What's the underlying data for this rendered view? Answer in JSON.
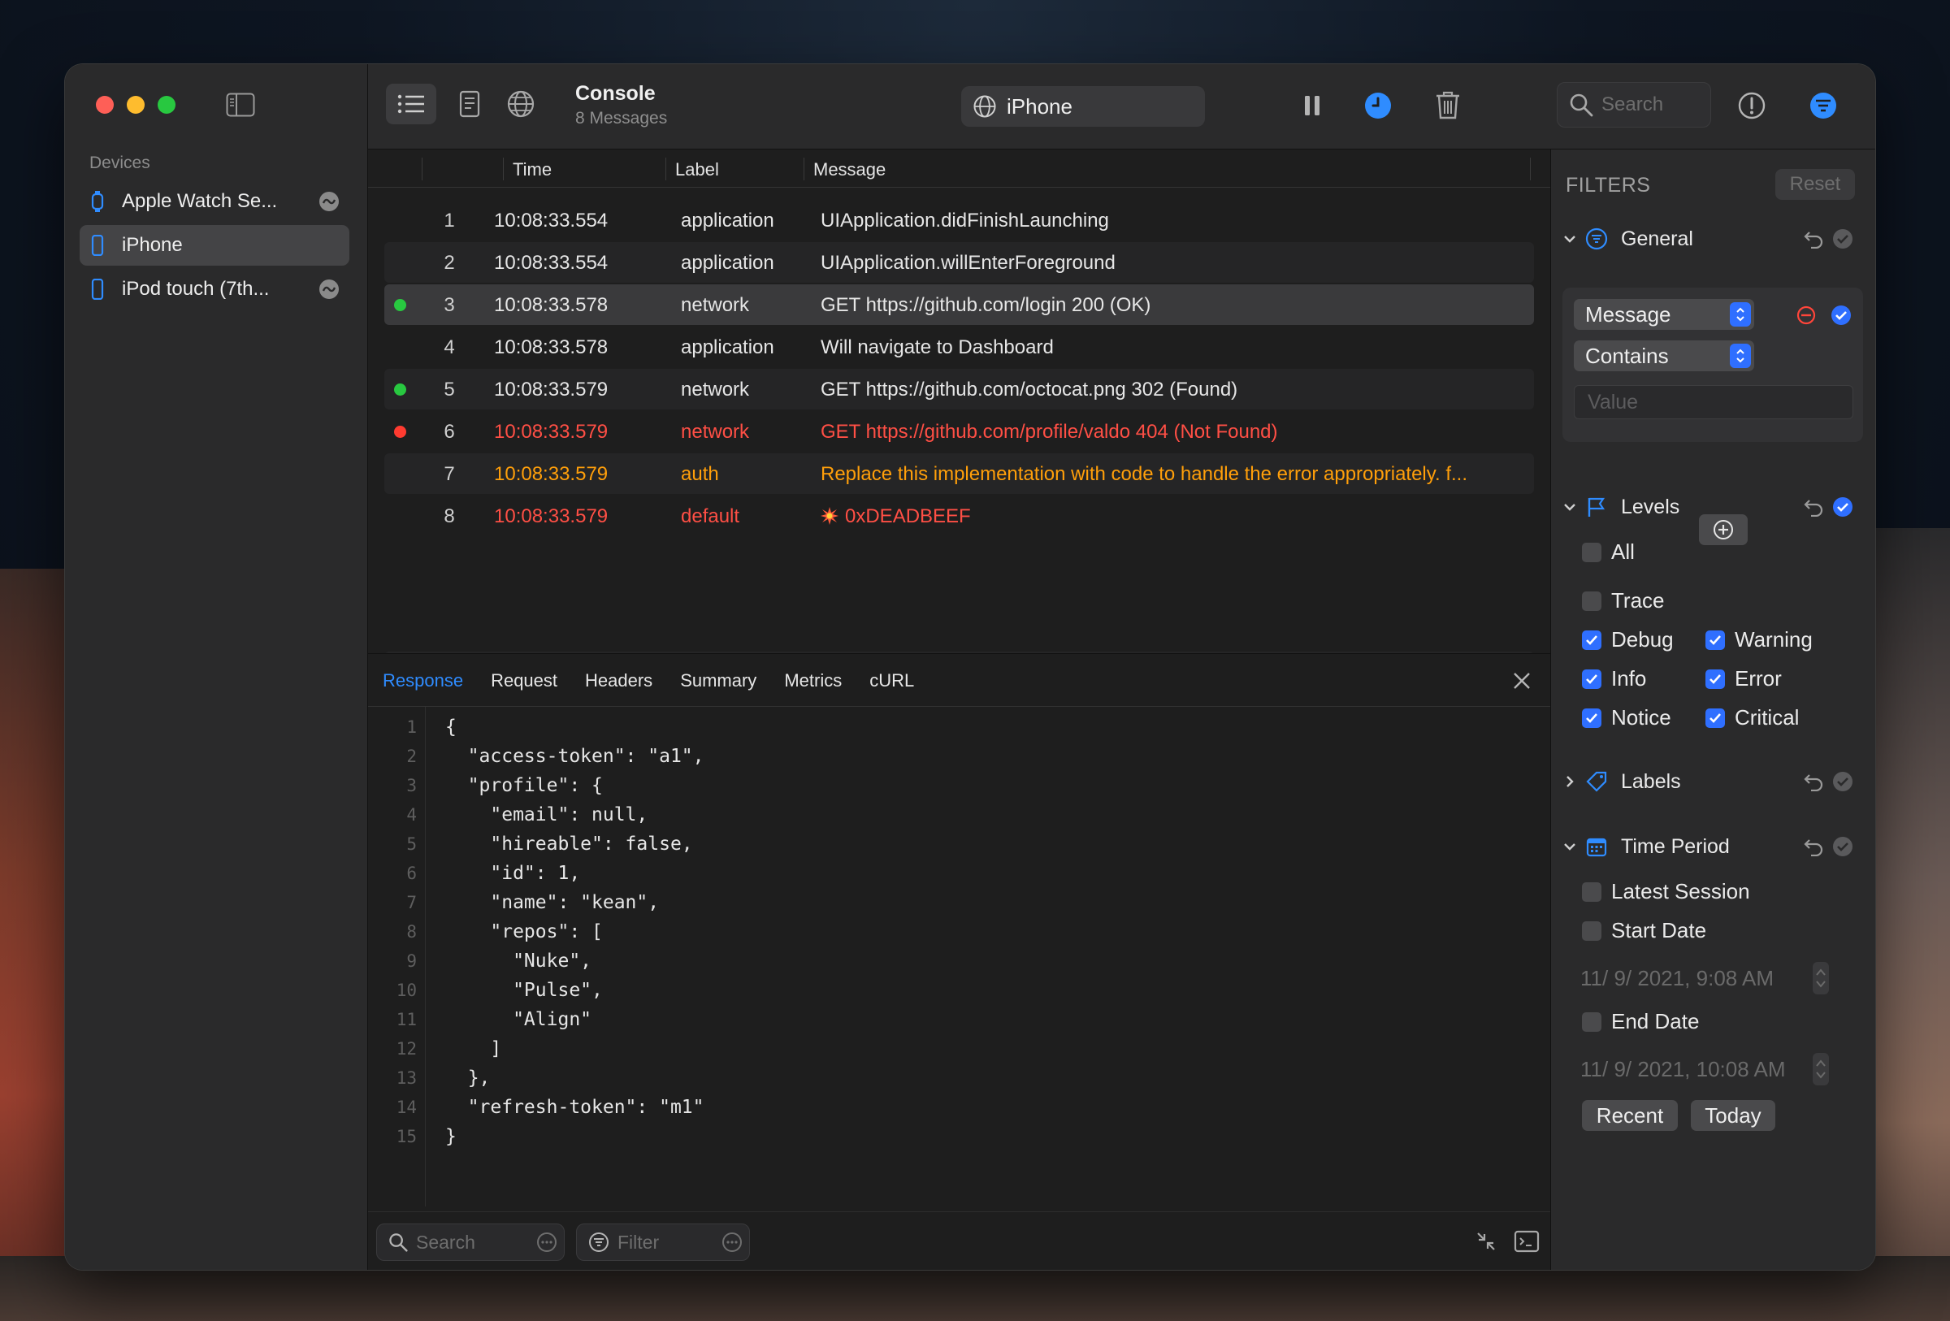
{
  "sidebar": {
    "heading": "Devices",
    "devices": [
      {
        "label": "Apple Watch Se...",
        "icon": "watch-icon"
      },
      {
        "label": "iPhone",
        "icon": "phone-icon",
        "selected": true
      },
      {
        "label": "iPod touch (7th...",
        "icon": "phone-icon"
      }
    ]
  },
  "toolbar": {
    "title": "Console",
    "subtitle": "8 Messages",
    "device": "iPhone",
    "search_placeholder": "Search"
  },
  "table": {
    "columns": [
      "Time",
      "Label",
      "Message"
    ],
    "rows": [
      {
        "num": "1",
        "time": "10:08:33.554",
        "label": "application",
        "message": "UIApplication.didFinishLaunching",
        "status": null,
        "level": "info"
      },
      {
        "num": "2",
        "time": "10:08:33.554",
        "label": "application",
        "message": "UIApplication.willEnterForeground",
        "status": null,
        "level": "info"
      },
      {
        "num": "3",
        "time": "10:08:33.578",
        "label": "network",
        "message": "GET https://github.com/login 200 (OK)",
        "status": "success",
        "level": "info"
      },
      {
        "num": "4",
        "time": "10:08:33.578",
        "label": "application",
        "message": "Will navigate to Dashboard",
        "status": null,
        "level": "info"
      },
      {
        "num": "5",
        "time": "10:08:33.579",
        "label": "network",
        "message": "GET https://github.com/octocat.png 302 (Found)",
        "status": "success",
        "level": "info"
      },
      {
        "num": "6",
        "time": "10:08:33.579",
        "label": "network",
        "message": "GET https://github.com/profile/valdo 404 (Not Found)",
        "status": "failure",
        "level": "error"
      },
      {
        "num": "7",
        "time": "10:08:33.579",
        "label": "auth",
        "message": "Replace this implementation with code to handle the error appropriately. f...",
        "status": null,
        "level": "warning"
      },
      {
        "num": "8",
        "time": "10:08:33.579",
        "label": "default",
        "message": "0xDEADBEEF",
        "status": null,
        "level": "critical"
      }
    ]
  },
  "detail": {
    "tabs": [
      "Response",
      "Request",
      "Headers",
      "Summary",
      "Metrics",
      "cURL"
    ],
    "active_tab": "Response",
    "search_placeholder": "Search",
    "filter_placeholder": "Filter"
  },
  "json_lines": [
    "{",
    "  \"access-token\": \"a1\",",
    "  \"profile\": {",
    "    \"email\": null,",
    "    \"hireable\": false,",
    "    \"id\": 1,",
    "    \"name\": \"kean\",",
    "    \"repos\": [",
    "      \"Nuke\",",
    "      \"Pulse\",",
    "      \"Align\"",
    "    ]",
    "  },",
    "  \"refresh-token\": \"m1\"",
    "}"
  ],
  "filters": {
    "title": "FILTERS",
    "reset": "Reset",
    "general": {
      "title": "General",
      "field": "Message",
      "match": "Contains",
      "value_placeholder": "Value"
    },
    "levels": {
      "title": "Levels",
      "all": "All",
      "trace": "Trace",
      "debug": "Debug",
      "warning": "Warning",
      "info": "Info",
      "error": "Error",
      "notice": "Notice",
      "critical": "Critical"
    },
    "labels": {
      "title": "Labels"
    },
    "time_period": {
      "title": "Time Period",
      "latest_session": "Latest Session",
      "start_date": "Start Date",
      "start_value": "11/  9/ 2021,   9:08 AM",
      "end_date": "End Date",
      "end_value": "11/  9/ 2021, 10:08 AM",
      "recent": "Recent",
      "today": "Today"
    }
  },
  "colors": {
    "accent": "#2f8cff",
    "success": "#28c840",
    "error": "#ff4f45",
    "warning": "#ff9f0a",
    "json_string": "#ff5e5a",
    "json_keyword": "#ff7ab2",
    "json_number": "#d9c97c"
  }
}
